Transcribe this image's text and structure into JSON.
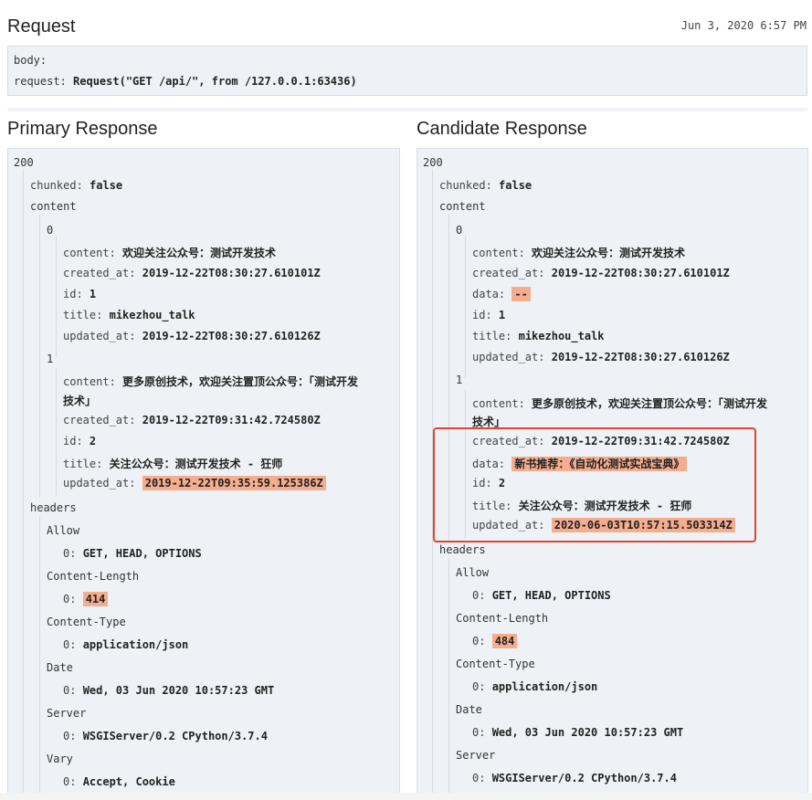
{
  "request": {
    "title": "Request",
    "timestamp": "Jun 3, 2020 6:57 PM",
    "body_key": "body:",
    "request_key": "request:",
    "request_value": "Request(\"GET /api/\", from /127.0.0.1:63436)"
  },
  "primary": {
    "title": "Primary Response",
    "status": "200",
    "chunked_key": "chunked:",
    "chunked_value": "false",
    "content_label": "content",
    "item0": {
      "index": "0",
      "content_key": "content:",
      "content_value": "欢迎关注公众号：测试开发技术",
      "created_at_key": "created_at:",
      "created_at_value": "2019-12-22T08:30:27.610101Z",
      "id_key": "id:",
      "id_value": "1",
      "title_key": "title:",
      "title_value": "mikezhou_talk",
      "updated_at_key": "updated_at:",
      "updated_at_value": "2019-12-22T08:30:27.610126Z"
    },
    "item1": {
      "index": "1",
      "content_key": "content:",
      "content_value_line1": "更多原创技术，欢迎关注置顶公众号：「测试开发",
      "content_value_line2": "技术」",
      "created_at_key": "created_at:",
      "created_at_value": "2019-12-22T09:31:42.724580Z",
      "id_key": "id:",
      "id_value": "2",
      "title_key": "title:",
      "title_value": "关注公众号：测试开发技术 - 狂师",
      "updated_at_key": "updated_at:",
      "updated_at_value": "2019-12-22T09:35:59.125386Z"
    },
    "headers_label": "headers",
    "allow_label": "Allow",
    "allow_value": "GET, HEAD, OPTIONS",
    "content_length_label": "Content-Length",
    "content_length_value": "414",
    "content_type_label": "Content-Type",
    "content_type_value": "application/json",
    "date_label": "Date",
    "date_value": "Wed, 03 Jun 2020 10:57:23 GMT",
    "server_label": "Server",
    "server_value": "WSGIServer/0.2 CPython/3.7.4",
    "vary_label": "Vary",
    "vary_value": "Accept, Cookie",
    "zero_key": "0:"
  },
  "candidate": {
    "title": "Candidate Response",
    "status": "200",
    "chunked_key": "chunked:",
    "chunked_value": "false",
    "content_label": "content",
    "item0": {
      "index": "0",
      "content_key": "content:",
      "content_value": "欢迎关注公众号：测试开发技术",
      "created_at_key": "created_at:",
      "created_at_value": "2019-12-22T08:30:27.610101Z",
      "data_key": "data:",
      "data_value": "--",
      "id_key": "id:",
      "id_value": "1",
      "title_key": "title:",
      "title_value": "mikezhou_talk",
      "updated_at_key": "updated_at:",
      "updated_at_value": "2019-12-22T08:30:27.610126Z"
    },
    "item1": {
      "index": "1",
      "content_key": "content:",
      "content_value_line1": "更多原创技术，欢迎关注置顶公众号：「测试开发",
      "content_value_line2": "技术」",
      "created_at_key": "created_at:",
      "created_at_value": "2019-12-22T09:31:42.724580Z",
      "data_key": "data:",
      "data_value": "新书推荐：《自动化测试实战宝典》",
      "id_key": "id:",
      "id_value": "2",
      "title_key": "title:",
      "title_value": "关注公众号：测试开发技术 - 狂师",
      "updated_at_key": "updated_at:",
      "updated_at_value": "2020-06-03T10:57:15.503314Z"
    },
    "headers_label": "headers",
    "allow_label": "Allow",
    "allow_value": "GET, HEAD, OPTIONS",
    "content_length_label": "Content-Length",
    "content_length_value": "484",
    "content_type_label": "Content-Type",
    "content_type_value": "application/json",
    "date_label": "Date",
    "date_value": "Wed, 03 Jun 2020 10:57:23 GMT",
    "server_label": "Server",
    "server_value": "WSGIServer/0.2 CPython/3.7.4",
    "zero_key": "0:"
  },
  "colors": {
    "diff_highlight": "#f4ad8e",
    "annotation_box": "#e0462f",
    "panel_background": "#eef2f6"
  }
}
